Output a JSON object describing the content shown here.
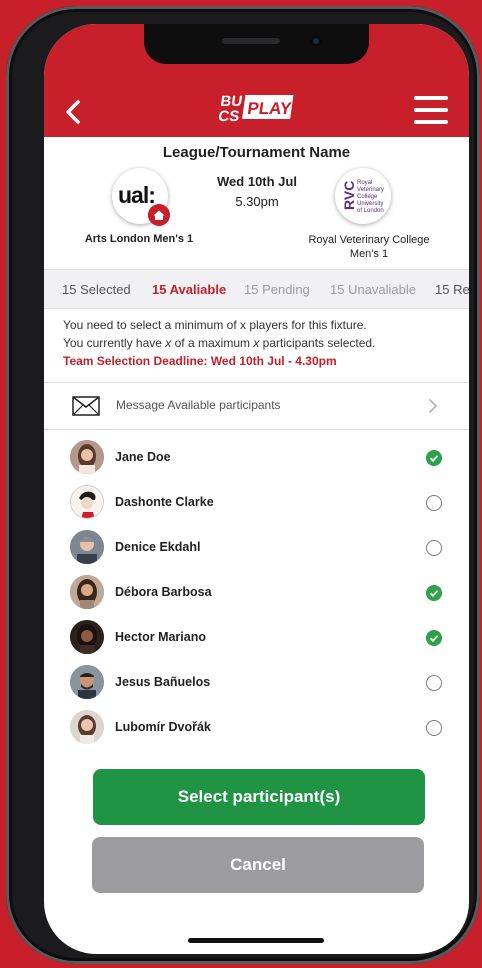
{
  "header": {
    "back_icon": "chevron-left-icon",
    "logo_text": "BUCS PLAY",
    "menu_icon": "hamburger-menu-icon",
    "brand_color": "#c8202a"
  },
  "fixture": {
    "title": "League/Tournament Name",
    "date": "Wed 10th Jul",
    "time": "5.30pm",
    "home_team": "Arts London Men's 1",
    "home_logo_text": "ual:",
    "away_team": "Royal Veterinary College Men's 1",
    "away_logo_text": "RVC",
    "away_logo_subtext": "Royal Veterinary College University of London"
  },
  "status_tabs": [
    {
      "label": "15 Selected"
    },
    {
      "label": "15 Avaliable"
    },
    {
      "label": "15 Pending"
    },
    {
      "label": "15 Unavaliable"
    },
    {
      "label": "15 Re"
    }
  ],
  "notice": {
    "line1": "You need to select a minimum of x players for this fixture.",
    "line2_pre": "You currently have ",
    "line2_x1": "x",
    "line2_mid": " of a maximum ",
    "line2_x2": "x",
    "line2_post": " participants selected.",
    "deadline": "Team Selection Deadline: Wed 10th Jul - 4.30pm"
  },
  "message": {
    "label": "Message Available participants",
    "icon": "envelope-icon"
  },
  "participants": [
    {
      "name": "Jane Doe",
      "selected": true
    },
    {
      "name": "Dashonte Clarke",
      "selected": false
    },
    {
      "name": "Denice Ekdahl",
      "selected": false
    },
    {
      "name": "Débora Barbosa",
      "selected": true
    },
    {
      "name": "Hector Mariano",
      "selected": true
    },
    {
      "name": "Jesus Bañuelos",
      "selected": false
    },
    {
      "name": "Lubomír Dvořák",
      "selected": false
    }
  ],
  "actions": {
    "select_label": "Select participant(s)",
    "cancel_label": "Cancel",
    "select_color": "#1f9444",
    "cancel_color": "#9c9c9e"
  }
}
